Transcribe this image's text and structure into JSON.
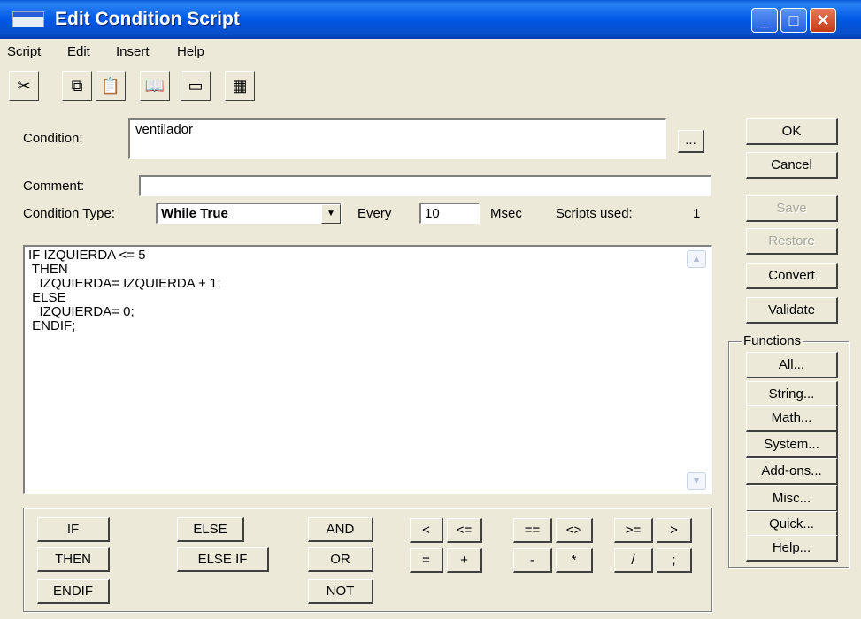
{
  "window": {
    "title": "Edit Condition Script",
    "controls": {
      "minimize": "_",
      "maximize": "□",
      "close": "✕"
    }
  },
  "menu": {
    "items": [
      "Script",
      "Edit",
      "Insert",
      "Help"
    ]
  },
  "toolbar": {
    "icons": [
      "cut-icon",
      "copy-icon",
      "paste-icon",
      "book-icon",
      "window-icon",
      "image-icon"
    ],
    "glyphs": [
      "✂",
      "⧉",
      "📋",
      "📖",
      "▭",
      "▦"
    ]
  },
  "form": {
    "condition_label": "Condition:",
    "condition_value": "ventilador",
    "browse_label": "...",
    "comment_label": "Comment:",
    "comment_value": "",
    "condition_type_label": "Condition Type:",
    "condition_type_value": "While True",
    "every_label": "Every",
    "every_value": "10",
    "msec_label": "Msec",
    "scripts_used_label": "Scripts used:",
    "scripts_used_value": "1"
  },
  "script": {
    "text": "IF IZQUIERDA <= 5\n THEN\n   IZQUIERDA= IZQUIERDA + 1;\n ELSE\n   IZQUIERDA= 0;\n ENDIF;"
  },
  "actions": {
    "ok": "OK",
    "cancel": "Cancel",
    "save": "Save",
    "restore": "Restore",
    "convert": "Convert",
    "validate": "Validate"
  },
  "functions": {
    "title": "Functions",
    "buttons": [
      "All...",
      "String...",
      "Math...",
      "System...",
      "Add-ons...",
      "Misc...",
      "Quick...",
      "Help..."
    ]
  },
  "keywords": {
    "if": "IF",
    "then": "THEN",
    "endif": "ENDIF",
    "else": "ELSE",
    "else_if": "ELSE IF",
    "and": "AND",
    "or": "OR",
    "not": "NOT",
    "lt": "<",
    "le": "<=",
    "eq": "==",
    "ne": "<>",
    "ge": ">=",
    "gt": ">",
    "assign": "=",
    "plus": "+",
    "minus": "-",
    "times": "*",
    "divide": "/",
    "semicolon": ";"
  },
  "colors": {
    "titlebar": "#0058e6",
    "face": "#ece9d8",
    "close": "#c43a14"
  }
}
